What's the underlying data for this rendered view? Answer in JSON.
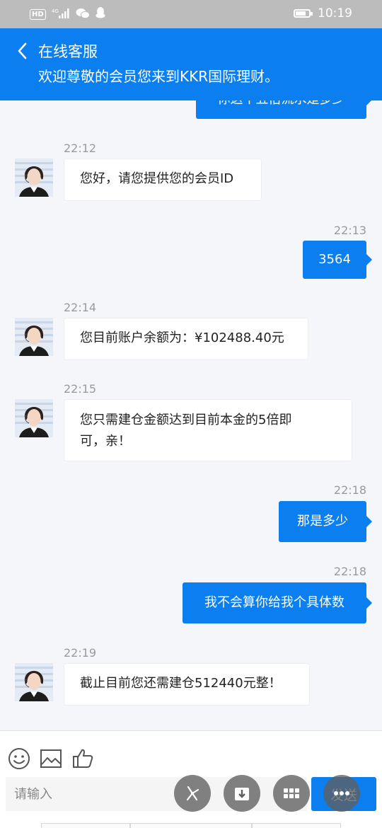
{
  "status_bar": {
    "left_icons": [
      "hd-icon",
      "signal-icon",
      "wechat-icon",
      "qq-icon"
    ],
    "hd_badge": "HD",
    "network": "4G",
    "time": "10:19"
  },
  "header": {
    "title": "在线客服",
    "subtitle": "欢迎尊敬的会员您来到KKR国际理财。"
  },
  "chat": {
    "partial_message": "你这个五倍流水是多少",
    "messages": [
      {
        "side": "agent",
        "time": "22:12",
        "text": "您好，请您提供您的会员ID"
      },
      {
        "side": "user",
        "time": "22:13",
        "text": "3564"
      },
      {
        "side": "agent",
        "time": "22:14",
        "text": "您目前账户余额为：¥102488.40元"
      },
      {
        "side": "agent",
        "time": "22:15",
        "text_line1": "您只需建仓金额达到目前本金的5倍即",
        "text_line2": "可，亲！"
      },
      {
        "side": "user",
        "time": "22:18",
        "text": "那是多少"
      },
      {
        "side": "user",
        "time": "22:18",
        "text": "我不会算你给我个具体数"
      },
      {
        "side": "agent",
        "time": "22:19",
        "text": "截止目前您还需建仓512440元整！"
      }
    ]
  },
  "input": {
    "placeholder": "请输入",
    "send_label": "发送",
    "toolbar_icons": [
      "emoji-icon",
      "image-icon",
      "thumbs-up-icon"
    ]
  },
  "floating_buttons": [
    "screenshot-icon",
    "download-icon",
    "grid-icon",
    "more-icon"
  ],
  "colors": {
    "accent": "#0b7ff0",
    "status_bar": "#bcbcbc",
    "chat_background": "#f5f6f9"
  }
}
